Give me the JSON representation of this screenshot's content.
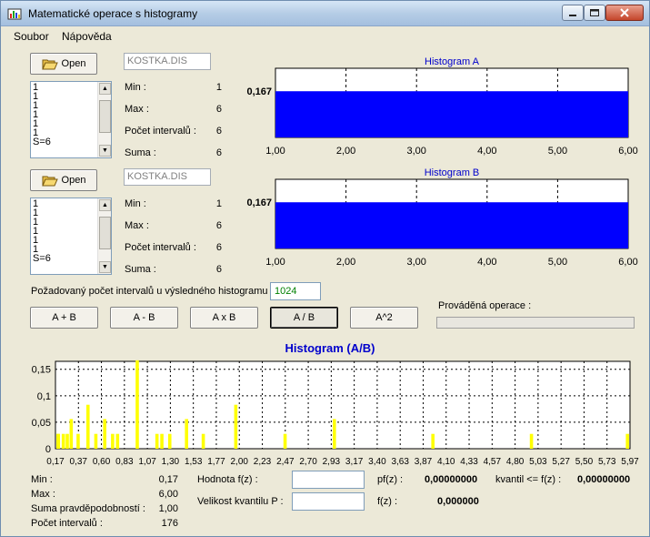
{
  "window": {
    "title": "Matematické operace s histogramy",
    "icon": "app-icon",
    "accent": "#0a246a"
  },
  "menu": [
    "Soubor",
    "Nápověda"
  ],
  "sourceA": {
    "open_label": "Open",
    "filename": "KOSTKA.DIS",
    "list": [
      "1",
      "1",
      "1",
      "1",
      "1",
      "1",
      "S=6"
    ],
    "labels": {
      "min": "Min :",
      "max": "Max :",
      "intervals": "Počet intervalů :",
      "sum": "Suma :"
    },
    "values": {
      "min": "1",
      "max": "6",
      "intervals": "6",
      "sum": "6"
    }
  },
  "sourceB": {
    "open_label": "Open",
    "filename": "KOSTKA.DIS",
    "list": [
      "1",
      "1",
      "1",
      "1",
      "1",
      "1",
      "S=6"
    ],
    "labels": {
      "min": "Min :",
      "max": "Max :",
      "intervals": "Počet intervalů :",
      "sum": "Suma :"
    },
    "values": {
      "min": "1",
      "max": "6",
      "intervals": "6",
      "sum": "6"
    }
  },
  "requested": {
    "label": "Požadovaný počet intervalů u výsledného histogramu :",
    "value": "1024"
  },
  "operations": [
    "A + B",
    "A - B",
    "A x B",
    "A / B",
    "A^2"
  ],
  "active_operation": "A / B",
  "progress": {
    "label": "Prováděná operace :",
    "fraction": 0
  },
  "chart_data": [
    {
      "type": "bar",
      "title": "Histogram A",
      "x_ticks": [
        "1,00",
        "2,00",
        "3,00",
        "4,00",
        "5,00",
        "6,00"
      ],
      "xlim": [
        1,
        6
      ],
      "bars": [
        {
          "x0": 1,
          "x1": 6,
          "value": 0.167
        }
      ],
      "y_label": "0,167",
      "ylim": [
        0,
        0.25
      ],
      "bar_color": "#0000ff",
      "title_color": "#0000cc",
      "grid": true
    },
    {
      "type": "bar",
      "title": "Histogram B",
      "x_ticks": [
        "1,00",
        "2,00",
        "3,00",
        "4,00",
        "5,00",
        "6,00"
      ],
      "xlim": [
        1,
        6
      ],
      "bars": [
        {
          "x0": 1,
          "x1": 6,
          "value": 0.167
        }
      ],
      "y_label": "0,167",
      "ylim": [
        0,
        0.25
      ],
      "bar_color": "#0000ff",
      "title_color": "#0000cc",
      "grid": true
    },
    {
      "type": "bar",
      "title": "Histogram (A/B)",
      "xlim": [
        0.17,
        6.0
      ],
      "ylim": [
        0,
        0.165
      ],
      "y_ticks": [
        {
          "v": 0,
          "t": "0"
        },
        {
          "v": 0.05,
          "t": "0,05"
        },
        {
          "v": 0.1,
          "t": "0,1"
        },
        {
          "v": 0.15,
          "t": "0,15"
        }
      ],
      "x_ticks": [
        "0,17",
        "0,37",
        "0,60",
        "0,83",
        "1,07",
        "1,30",
        "1,53",
        "1,77",
        "2,00",
        "2,23",
        "2,47",
        "2,70",
        "2,93",
        "3,17",
        "3,40",
        "3,63",
        "3,87",
        "4,10",
        "4,33",
        "4,57",
        "4,80",
        "5,03",
        "5,27",
        "5,50",
        "5,73",
        "5,97"
      ],
      "bar_width": 0.0331,
      "bars": [
        {
          "x": 0.17,
          "y": 0.028
        },
        {
          "x": 0.2,
          "y": 0.028
        },
        {
          "x": 0.25,
          "y": 0.028
        },
        {
          "x": 0.29,
          "y": 0.028
        },
        {
          "x": 0.33,
          "y": 0.056
        },
        {
          "x": 0.4,
          "y": 0.028
        },
        {
          "x": 0.5,
          "y": 0.083
        },
        {
          "x": 0.58,
          "y": 0.028
        },
        {
          "x": 0.67,
          "y": 0.056
        },
        {
          "x": 0.75,
          "y": 0.028
        },
        {
          "x": 0.8,
          "y": 0.028
        },
        {
          "x": 1.0,
          "y": 0.167
        },
        {
          "x": 1.2,
          "y": 0.028
        },
        {
          "x": 1.25,
          "y": 0.028
        },
        {
          "x": 1.33,
          "y": 0.028
        },
        {
          "x": 1.5,
          "y": 0.056
        },
        {
          "x": 1.67,
          "y": 0.028
        },
        {
          "x": 2.0,
          "y": 0.083
        },
        {
          "x": 2.5,
          "y": 0.028
        },
        {
          "x": 3.0,
          "y": 0.056
        },
        {
          "x": 4.0,
          "y": 0.028
        },
        {
          "x": 5.0,
          "y": 0.028
        },
        {
          "x": 6.0,
          "y": 0.028
        }
      ],
      "bar_color": "#ffff00",
      "title_color": "#0000cc",
      "grid": true
    }
  ],
  "result": {
    "labels": {
      "min": "Min :",
      "max": "Max :",
      "sum": "Suma pravděpodobností :",
      "intervals": "Počet intervalů :"
    },
    "values": {
      "min": "0,17",
      "max": "6,00",
      "sum": "1,00",
      "intervals": "176"
    }
  },
  "query": {
    "fz_label": "Hodnota f(z) :",
    "fz_value": "",
    "quantile_label": "Velikost kvantilu P :",
    "quantile_value": "",
    "pfz_label": "pf(z) :",
    "pfz_value": "0,00000000",
    "kvantil_label": "kvantil <= f(z) :",
    "kvantil_value": "0,00000000",
    "fz2_label": "f(z) :",
    "fz2_value": "0,000000"
  }
}
